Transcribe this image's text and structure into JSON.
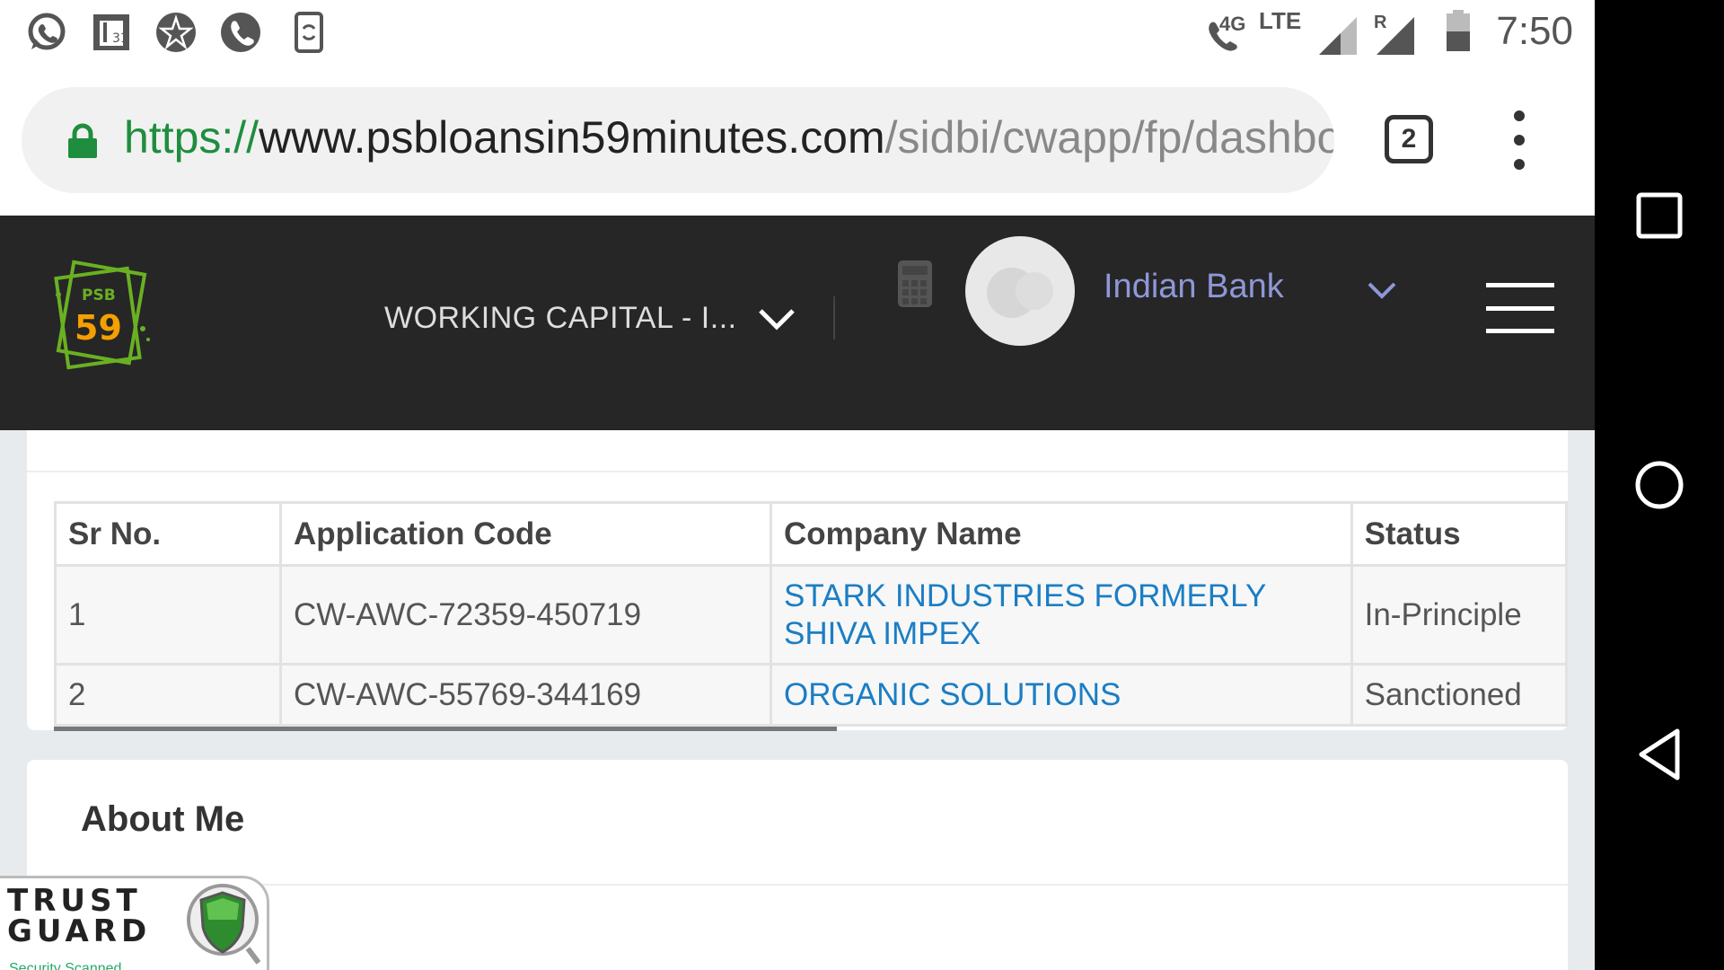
{
  "status_bar": {
    "time": "7:50",
    "network": "LTE",
    "network_small": "4G",
    "roaming": "R",
    "left_icons": [
      "whatsapp-icon",
      "calendar-icon",
      "app-icon",
      "phone-icon",
      "phone-sync-icon"
    ]
  },
  "browser": {
    "url_scheme": "https://",
    "url_host": "www.psbloansin59minutes.com",
    "url_path": "/sidbi/cwapp/fp/dashboard",
    "tab_count": "2"
  },
  "header": {
    "logo_top": "PSB",
    "logo_number": "59",
    "module_selected": "WORKING CAPITAL - I...",
    "bank_name": "Indian Bank"
  },
  "applications_table": {
    "columns": [
      "Sr No.",
      "Application Code",
      "Company Name",
      "Status"
    ],
    "rows": [
      {
        "sr": "1",
        "code": "CW-AWC-72359-450719",
        "company": "STARK INDUSTRIES FORMERLY SHIVA IMPEX",
        "status": "In-Principle"
      },
      {
        "sr": "2",
        "code": "CW-AWC-55769-344169",
        "company": "ORGANIC SOLUTIONS",
        "status": "Sanctioned"
      }
    ]
  },
  "about": {
    "title": "About Me"
  },
  "trust_badge": {
    "line1": "TRUST",
    "line2": "GUARD",
    "caption": "Security Scanned"
  },
  "colors": {
    "header_bg": "#262626",
    "link": "#1b7ec4",
    "bank_name": "#8f97d8",
    "url_secure": "#1e8e3e"
  }
}
